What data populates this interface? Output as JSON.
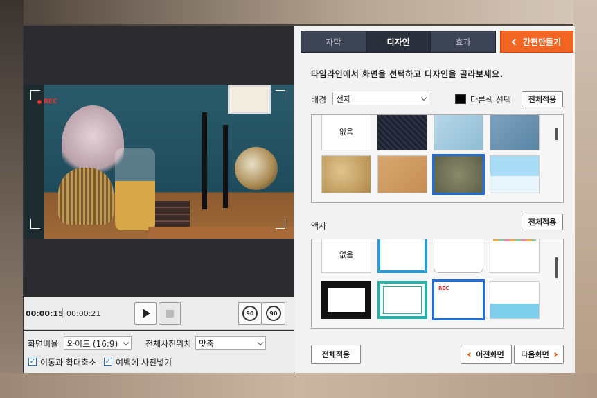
{
  "preview": {
    "rec_label": "REC"
  },
  "player": {
    "current_time": "00:00:15",
    "total_time": "00:00:21",
    "rotate_left_label": "90",
    "rotate_right_label": "90"
  },
  "options": {
    "aspect_label": "화면비율",
    "aspect_value": "와이드 (16:9)",
    "position_label": "전체사진위치",
    "position_value": "맞춤",
    "motion_label": "이동과 확대축소",
    "margin_label": "여백에 사진넣기"
  },
  "tabs": [
    {
      "label": "자막"
    },
    {
      "label": "디자인"
    },
    {
      "label": "효과"
    }
  ],
  "easy_button": "간편만들기",
  "instruction": "타임라인에서 화면을 선택하고 디자인을 골라보세요.",
  "background": {
    "label": "배경",
    "select_value": "전체",
    "other_color_label": "다른색 선택",
    "apply_all": "전체적용",
    "tiles": [
      {
        "label": "없음",
        "kind": "none"
      },
      {
        "label": "",
        "kind": "dark-pattern"
      },
      {
        "label": "",
        "kind": "light-blue"
      },
      {
        "label": "",
        "kind": "steel-blue"
      },
      {
        "label": "",
        "kind": "old-paper"
      },
      {
        "label": "",
        "kind": "kraft"
      },
      {
        "label": "",
        "kind": "olive-texture",
        "selected": true
      },
      {
        "label": "",
        "kind": "clouds"
      }
    ]
  },
  "frame": {
    "label": "액자",
    "apply_all": "전체적용",
    "tiles": [
      {
        "label": "없음",
        "kind": "none"
      },
      {
        "label": "",
        "kind": "blue-border"
      },
      {
        "label": "",
        "kind": "rounded-white"
      },
      {
        "label": "",
        "kind": "bunting"
      },
      {
        "label": "",
        "kind": "film-strip"
      },
      {
        "label": "",
        "kind": "teal-border"
      },
      {
        "label": "REC",
        "kind": "rec-frame",
        "selected": true
      },
      {
        "label": "",
        "kind": "whale"
      }
    ]
  },
  "footer": {
    "apply_all": "전체적용",
    "prev": "이전화면",
    "next": "다음화면"
  },
  "colors": {
    "accent": "#f26522",
    "selection": "#1f6fd8",
    "tab_bg": "#3c4456"
  }
}
